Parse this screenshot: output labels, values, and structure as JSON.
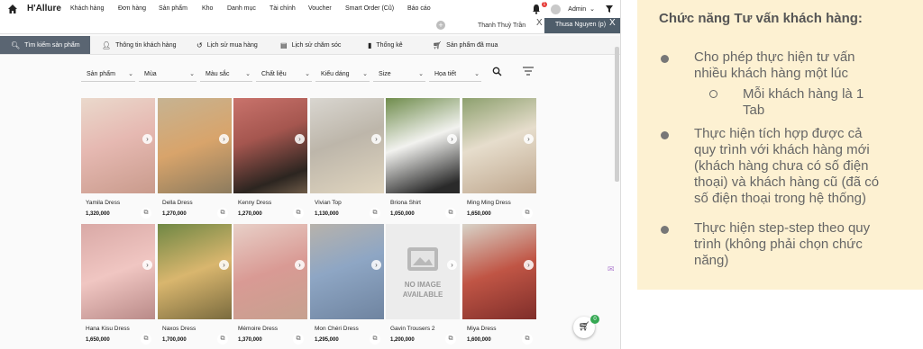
{
  "app": {
    "brand": "H'Allure",
    "menu": [
      "Khách hàng",
      "Đơn hàng",
      "Sản phẩm",
      "Kho",
      "Danh mục",
      "Tài chính",
      "Voucher",
      "Smart Order (Cũ)",
      "Báo cáo"
    ],
    "notification_count": "1",
    "user": "Admin",
    "customer_tabs": [
      {
        "label": "Thanh Thuỳ Trần",
        "close": "X"
      },
      {
        "label": "Thusa Nguyen (p)",
        "close": "X"
      }
    ],
    "add_tab": "+",
    "function_tabs": [
      {
        "label": "Tìm kiếm sản phẩm",
        "icon": "search-icon"
      },
      {
        "label": "Thông tin khách hàng",
        "icon": "user-icon"
      },
      {
        "label": "Lịch sử mua hàng",
        "icon": "history-icon"
      },
      {
        "label": "Lịch sử chăm sóc",
        "icon": "care-icon"
      },
      {
        "label": "Thống kê",
        "icon": "chart-icon"
      },
      {
        "label": "Sản phẩm đã mua",
        "icon": "cart-icon"
      }
    ],
    "filters": [
      "Sản phẩm",
      "Mùa",
      "Màu sắc",
      "Chất liệu",
      "Kiểu dáng",
      "Size",
      "Họa tiết"
    ],
    "products": [
      {
        "name": "Yamila Dress",
        "price": "1,320,000"
      },
      {
        "name": "Della Dress",
        "price": "1,270,000"
      },
      {
        "name": "Kenny Dress",
        "price": "1,270,000"
      },
      {
        "name": "Vivian Top",
        "price": "1,130,000"
      },
      {
        "name": "Briona Shirt",
        "price": "1,050,000"
      },
      {
        "name": "Ming Ming Dress",
        "price": "1,650,000"
      },
      {
        "name": "Hana Kisu Dress",
        "price": "1,650,000"
      },
      {
        "name": "Naxos Dress",
        "price": "1,700,000"
      },
      {
        "name": "Mémoire Dress",
        "price": "1,370,000"
      },
      {
        "name": "Mon Chéri Dress",
        "price": "1,295,000"
      },
      {
        "name": "Gavin Trousers 2",
        "price": "1,200,000"
      },
      {
        "name": "Miya Dress",
        "price": "1,600,000"
      }
    ],
    "no_image_line1": "NO IMAGE",
    "no_image_line2": "AVAILABLE",
    "cart_count": "0"
  },
  "note": {
    "title": "Chức năng Tư vấn khách hàng:",
    "bullets": [
      {
        "lines": [
          "Cho phép thực hiện tư vấn",
          "nhiều khách hàng một lúc"
        ]
      },
      {
        "lines": [
          "Mỗi khách hàng là 1",
          "Tab"
        ]
      },
      {
        "lines": [
          "Thực hiện tích hợp được cả",
          "quy trình với khách hàng mới",
          "(khách hàng chưa có số điện",
          "thoại) và khách hàng cũ (đã có",
          "số điện thoại trong hệ thống)"
        ]
      },
      {
        "lines": [
          "Thực hiện step-step theo quy",
          "trình (không phải chọn chức",
          "năng)"
        ]
      }
    ]
  },
  "colors": {
    "active_tab": "#5a6572",
    "note_bg": "#fdf1d2",
    "badge_red": "#e53935",
    "cart_badge": "#35a853"
  }
}
